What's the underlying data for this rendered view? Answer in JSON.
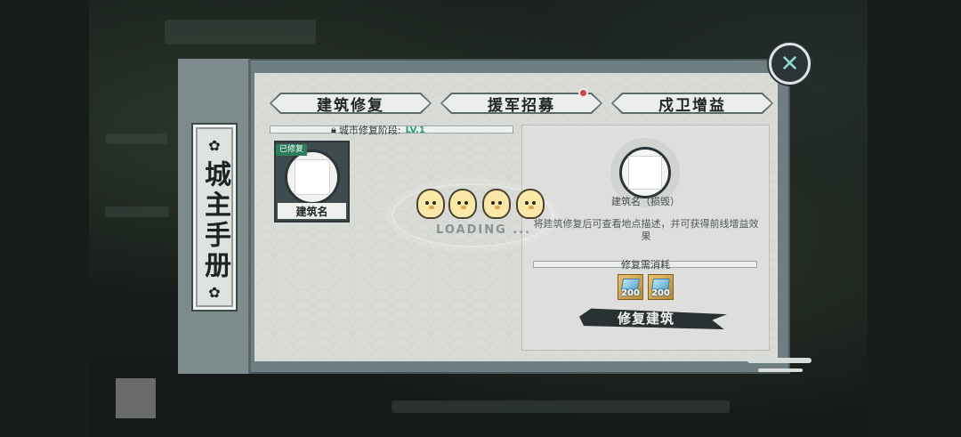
{
  "handbook": {
    "title": "城主手册",
    "close_icon": "close-icon"
  },
  "tabs": [
    {
      "label": "建筑修复",
      "active": true
    },
    {
      "label": "援军招募",
      "has_badge": true
    },
    {
      "label": "戍卫增益"
    }
  ],
  "stage": {
    "label": "城市修复阶段:",
    "level": "LV.1"
  },
  "building": {
    "badge": "已修复",
    "name": "建筑名"
  },
  "loading": {
    "text": "LOADING ..."
  },
  "detail": {
    "name": "建筑名（损毁）",
    "description": "将建筑修复后可查看地点描述，并可获得前线增益效果",
    "cost_label": "修复需消耗",
    "costs": [
      {
        "amount": "200",
        "icon": "ticket-icon"
      },
      {
        "amount": "200",
        "icon": "ticket-icon"
      }
    ],
    "repair_button": "修复建筑"
  },
  "colors": {
    "accent_green": "#2e7d5c",
    "badge_red": "#c84a4a",
    "level_teal": "#2f9a7a"
  }
}
